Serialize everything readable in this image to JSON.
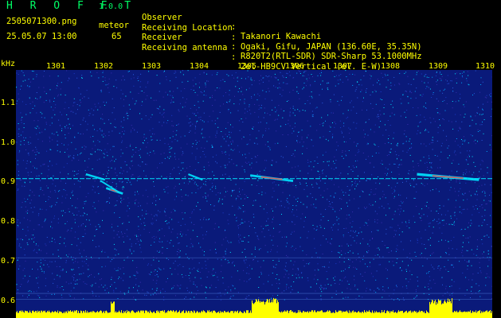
{
  "header": {
    "app_title": "H R O F F T",
    "version": "1.0.0",
    "file_name": "2505071300.png",
    "date_time": "25.05.07 13:00",
    "mode": "meteor",
    "count": "65"
  },
  "info": [
    {
      "label": "Observer",
      "value": "Takanori Kawachi"
    },
    {
      "label": "Receiving Location",
      "value": "Ogaki, Gifu, JAPAN (136.60E, 35.35N)"
    },
    {
      "label": "Receiver",
      "value": "R820T2(RTL-SDR) SDR-Sharp 53.1000MHz"
    },
    {
      "label": "Receiving antenna",
      "value": "2el-HB9CV Vertical (el. E-W)"
    }
  ],
  "separator": ":",
  "y_axis": {
    "unit": "kHz",
    "ticks": [
      "1.1",
      "1.0",
      "0.9",
      "0.8",
      "0.7",
      "0.6"
    ],
    "range": [
      0.58,
      1.16
    ]
  },
  "x_axis": {
    "ticks": [
      "1301",
      "1302",
      "1303",
      "1304",
      "1305",
      "1306",
      "1307",
      "1308",
      "1309",
      "1310"
    ]
  },
  "colors": {
    "background": "#000000",
    "header_text": "#ffff00",
    "title_text": "#00ff66",
    "plot_background": "#0a1a7a",
    "signal": "#00e5ff",
    "level_bar": "#ffff00"
  },
  "spectrogram": {
    "carrier_khz": 0.91,
    "meteor_echoes": [
      {
        "minute": 1301.9,
        "khz": 0.915,
        "length": 0.4,
        "strength": 0.5
      },
      {
        "minute": 1302.3,
        "khz": 0.88,
        "length": 0.35,
        "strength": 0.8
      },
      {
        "minute": 1304.0,
        "khz": 0.915,
        "length": 0.3,
        "strength": 0.4
      },
      {
        "minute": 1305.6,
        "khz": 0.912,
        "length": 0.9,
        "strength": 0.7
      },
      {
        "minute": 1309.3,
        "khz": 0.915,
        "length": 1.3,
        "strength": 1.0
      }
    ]
  }
}
